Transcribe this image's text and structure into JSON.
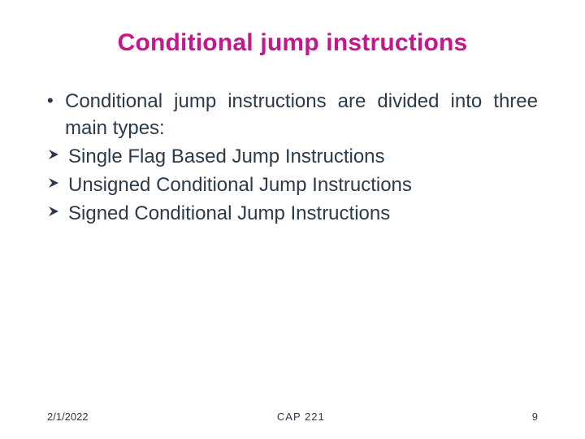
{
  "title": "Conditional jump instructions",
  "bullet": {
    "text": "Conditional jump instructions are divided into three main types:"
  },
  "arrows": [
    {
      "text": "Single Flag Based Jump Instructions"
    },
    {
      "text": "Unsigned Conditional Jump Instructions"
    },
    {
      "text": "Signed Conditional Jump Instructions"
    }
  ],
  "footer": {
    "date": "2/1/2022",
    "course": "CAP 221",
    "page": "9"
  },
  "colors": {
    "title": "#c5168c",
    "body": "#2b3a4a"
  }
}
